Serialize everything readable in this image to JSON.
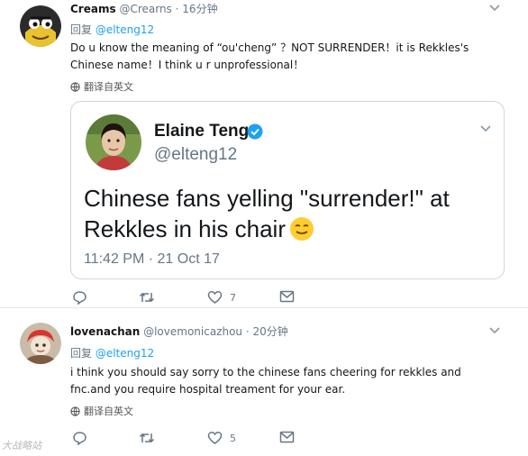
{
  "tweets": [
    {
      "name": "Creams",
      "handle": "@Crearns",
      "separator": "·",
      "time": "16分钟",
      "reply_prefix": "回复",
      "reply_to": "@elteng12",
      "body": "Do u know the meaning of “ou'cheng” ？NOT SURRENDER！it is Rekkles's Chinese name！I think u r unprofessional！",
      "translate_label": "翻译自英文",
      "actions": {
        "reply_count": "",
        "retweet_count": "",
        "like_count": "7"
      }
    },
    {
      "name": "lovenachan",
      "handle": "@lovemonicazhou",
      "separator": "·",
      "time": "20分钟",
      "reply_prefix": "回复",
      "reply_to": "@elteng12",
      "body": "i think you should say sorry to the chinese fans cheering for rekkles and fnc.and you require hospital treament for your ear.",
      "translate_label": "翻译自英文",
      "actions": {
        "reply_count": "",
        "retweet_count": "",
        "like_count": "5"
      }
    }
  ],
  "quoted_tweet": {
    "name": "Elaine Teng",
    "handle": "@elteng12",
    "text": "Chinese fans yelling \"surrender!\" at Rekkles in his chair",
    "timestamp": "11:42 PM · 21 Oct 17"
  },
  "watermark": "大战略站",
  "colors": {
    "link": "#1da1f2",
    "secondary_text": "#657786",
    "border": "#e1e8ed"
  },
  "icons": [
    "reply-icon",
    "retweet-icon",
    "like-icon",
    "direct-message-icon",
    "verified-badge-icon",
    "chevron-down-icon",
    "translate-globe-icon",
    "grinning-emoji"
  ]
}
